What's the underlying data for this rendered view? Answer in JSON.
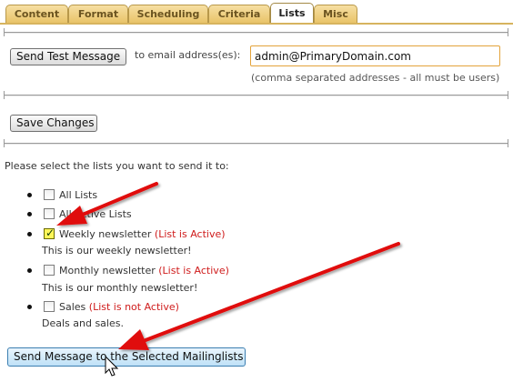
{
  "tabs": [
    {
      "label": "Content",
      "active": false
    },
    {
      "label": "Format",
      "active": false
    },
    {
      "label": "Scheduling",
      "active": false
    },
    {
      "label": "Criteria",
      "active": false
    },
    {
      "label": "Lists",
      "active": true
    },
    {
      "label": "Misc",
      "active": false
    }
  ],
  "test": {
    "button": "Send Test Message",
    "to_label": "to email address(es):",
    "email_value": "admin@PrimaryDomain.com",
    "note": "(comma separated addresses - all must be users)"
  },
  "save_button": "Save Changes",
  "prompt": "Please select the lists you want to send it to:",
  "lists": [
    {
      "label": "All Lists",
      "checked": false
    },
    {
      "label": "All Active Lists",
      "checked": false
    },
    {
      "label": "Weekly newsletter",
      "status": "List is Active",
      "description": "This is our weekly newsletter!",
      "checked": true
    },
    {
      "label": "Monthly newsletter",
      "status": "List is Active",
      "description": "This is our monthly newsletter!",
      "checked": false
    },
    {
      "label": "Sales",
      "status": "List is not Active",
      "description": "Deals and sales.",
      "checked": false
    }
  ],
  "send_button": "Send Message to the Selected Mailinglists",
  "colors": {
    "accent": "#e9c469",
    "arrow": "#e01010",
    "status": "#cf1b1b"
  }
}
